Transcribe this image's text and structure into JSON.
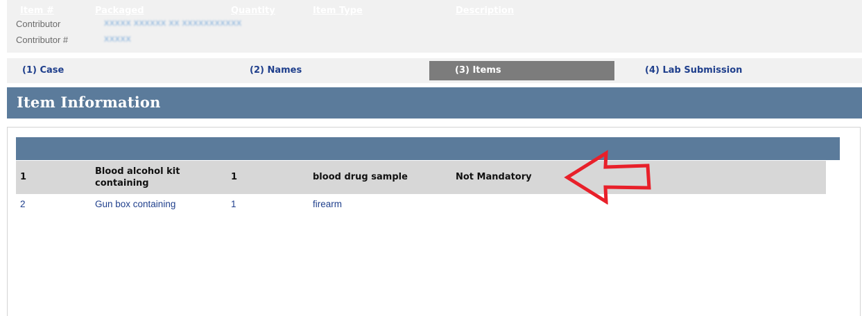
{
  "contributor": {
    "label": "Contributor",
    "value": "XXXXX XXXXXX XX XXXXXXXXXXX",
    "number_label": "Contributor #",
    "number_value": "XXXXX"
  },
  "tabs": [
    {
      "label": "(1) Case",
      "active": false
    },
    {
      "label": "(2) Names",
      "active": false
    },
    {
      "label": "(3) Items",
      "active": true
    },
    {
      "label": "(4) Lab Submission",
      "active": false
    }
  ],
  "section": {
    "title": "Item Information"
  },
  "table": {
    "columns": [
      "Item #",
      "Packaged",
      "Quantity",
      "Item Type",
      "Description"
    ],
    "rows": [
      {
        "item": "1",
        "packaged": "Blood alcohol kit containing",
        "quantity": "1",
        "item_type": "blood drug sample",
        "description": "Not Mandatory"
      },
      {
        "item": "2",
        "packaged": "Gun box containing",
        "quantity": "1",
        "item_type": "firearm",
        "description": ""
      }
    ]
  },
  "colors": {
    "header_bg": "#5b7b9b",
    "active_tab_bg": "#7c7c7c",
    "link_color": "#1f3f8c",
    "selected_row_bg": "#d7d7d7",
    "annotation_arrow": "#e8202a"
  },
  "icons": {
    "annotation": "red-outline-arrow-icon"
  }
}
